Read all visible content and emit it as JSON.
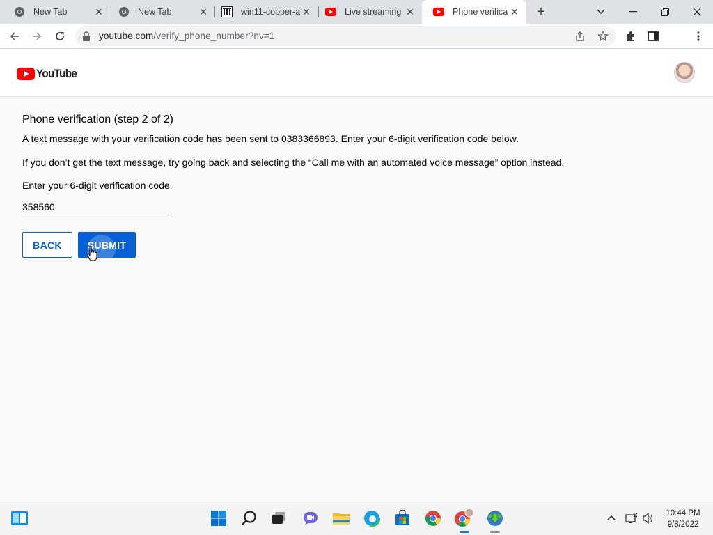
{
  "browser": {
    "tabs": [
      {
        "title": "New Tab",
        "icon": "chrome-icon",
        "active": false
      },
      {
        "title": "New Tab",
        "icon": "chrome-icon",
        "active": false
      },
      {
        "title": "win11-copper-a",
        "icon": "bank-icon",
        "active": false
      },
      {
        "title": "Live streaming -",
        "icon": "youtube-icon",
        "active": false
      },
      {
        "title": "Phone verificatio",
        "icon": "youtube-icon",
        "active": true
      }
    ],
    "address": {
      "host": "youtube.com",
      "path": "/verify_phone_number?nv=1"
    }
  },
  "header": {
    "logo_text": "YouTube"
  },
  "page": {
    "title": "Phone verification (step 2 of 2)",
    "message": "A text message with your verification code has been sent to 0383366893. Enter your 6-digit verification code below.",
    "fallback_message": "If you don’t get the text message, try going back and selecting the “Call me with an automated voice message” option instead.",
    "field_label": "Enter your 6-digit verification code",
    "code_value": "358560",
    "back_label": "BACK",
    "submit_label": "SUBMIT"
  },
  "taskbar": {
    "time": "10:44 PM",
    "date": "9/8/2022"
  },
  "colors": {
    "youtube_red": "#ff0000",
    "accent_blue": "#065fd4"
  }
}
